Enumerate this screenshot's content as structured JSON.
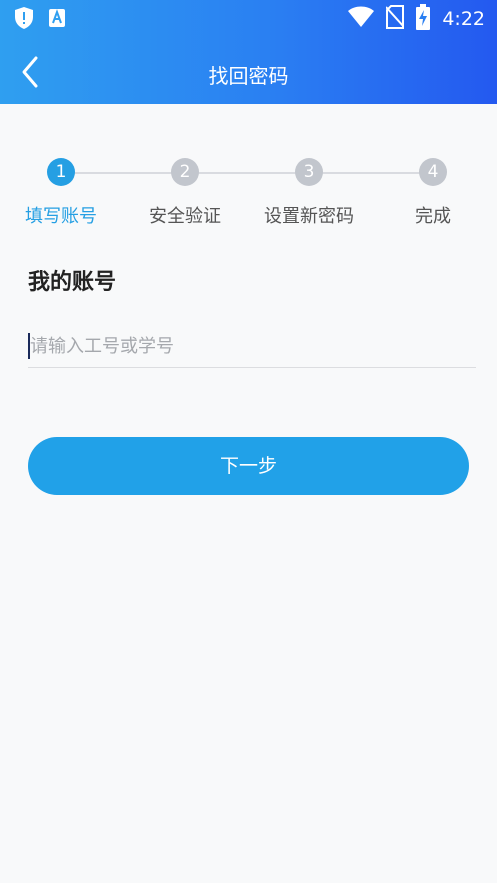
{
  "status_bar": {
    "icons_left": [
      "shield-alert-icon",
      "text-a-icon"
    ],
    "icons_right": [
      "wifi-icon",
      "no-sim-icon",
      "battery-charging-icon"
    ],
    "time": "4:22"
  },
  "nav": {
    "title": "找回密码",
    "back_icon": "chevron-left-icon"
  },
  "steps": [
    {
      "number": "1",
      "label": "填写账号",
      "active": true
    },
    {
      "number": "2",
      "label": "安全验证",
      "active": false
    },
    {
      "number": "3",
      "label": "设置新密码",
      "active": false
    },
    {
      "number": "4",
      "label": "完成",
      "active": false
    }
  ],
  "form": {
    "section_title": "我的账号",
    "account_input": {
      "value": "",
      "placeholder": "请输入工号或学号"
    },
    "next_label": "下一步"
  },
  "colors": {
    "header_gradient": [
      "#2f9ff0",
      "#2459f0"
    ],
    "accent": "#259fe3",
    "button": "#21a1e8",
    "step_inactive": "#c2c6cd",
    "background": "#f8f9fa"
  }
}
